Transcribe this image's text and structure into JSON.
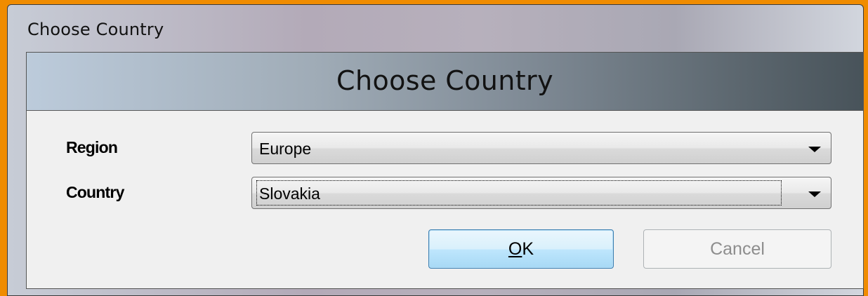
{
  "window": {
    "title": "Choose Country"
  },
  "header": {
    "title": "Choose Country"
  },
  "form": {
    "region_label": "Region",
    "region_value": "Europe",
    "country_label": "Country",
    "country_value": "Slovakia"
  },
  "buttons": {
    "ok_mnemonic": "O",
    "ok_rest": "K",
    "cancel_label": "Cancel"
  },
  "colors": {
    "background": "#f08c00",
    "ok_border": "#3c7fb1"
  },
  "icons": {
    "dropdown": "chevron-down-icon"
  }
}
